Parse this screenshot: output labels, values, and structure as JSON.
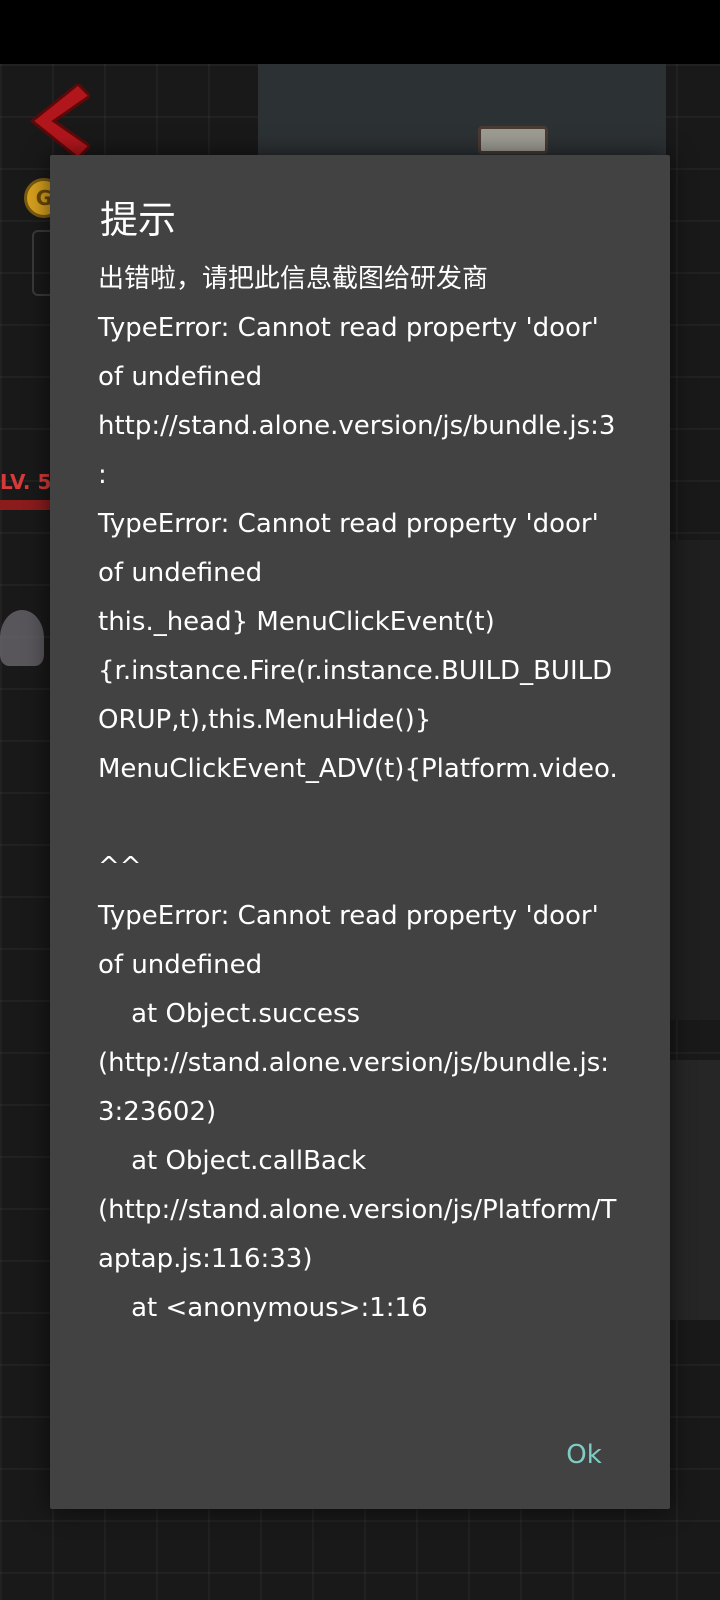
{
  "background": {
    "level_label": "LV. 5",
    "coin_label": "G"
  },
  "dialog": {
    "title": "提示",
    "message": "出错啦，请把此信息截图给研发商\nTypeError: Cannot read property 'door' of undefined\nhttp://stand.alone.version/js/bundle.js:3:\nTypeError: Cannot read property 'door' of undefined\nthis._head} MenuClickEvent(t){r.instance.Fire(r.instance.BUILD_BUILDORUP,t),this.MenuHide()} MenuClickEvent_ADV(t){Platform.video.\n\n^^\nTypeError: Cannot read property 'door' of undefined\n    at Object.success (http://stand.alone.version/js/bundle.js:3:23602)\n    at Object.callBack (http://stand.alone.version/js/Platform/Taptap.js:116:33)\n    at <anonymous>:1:16",
    "ok_label": "Ok"
  },
  "colors": {
    "dialog_bg": "#424242",
    "button_text": "#80cbc4",
    "text": "#ffffff"
  }
}
